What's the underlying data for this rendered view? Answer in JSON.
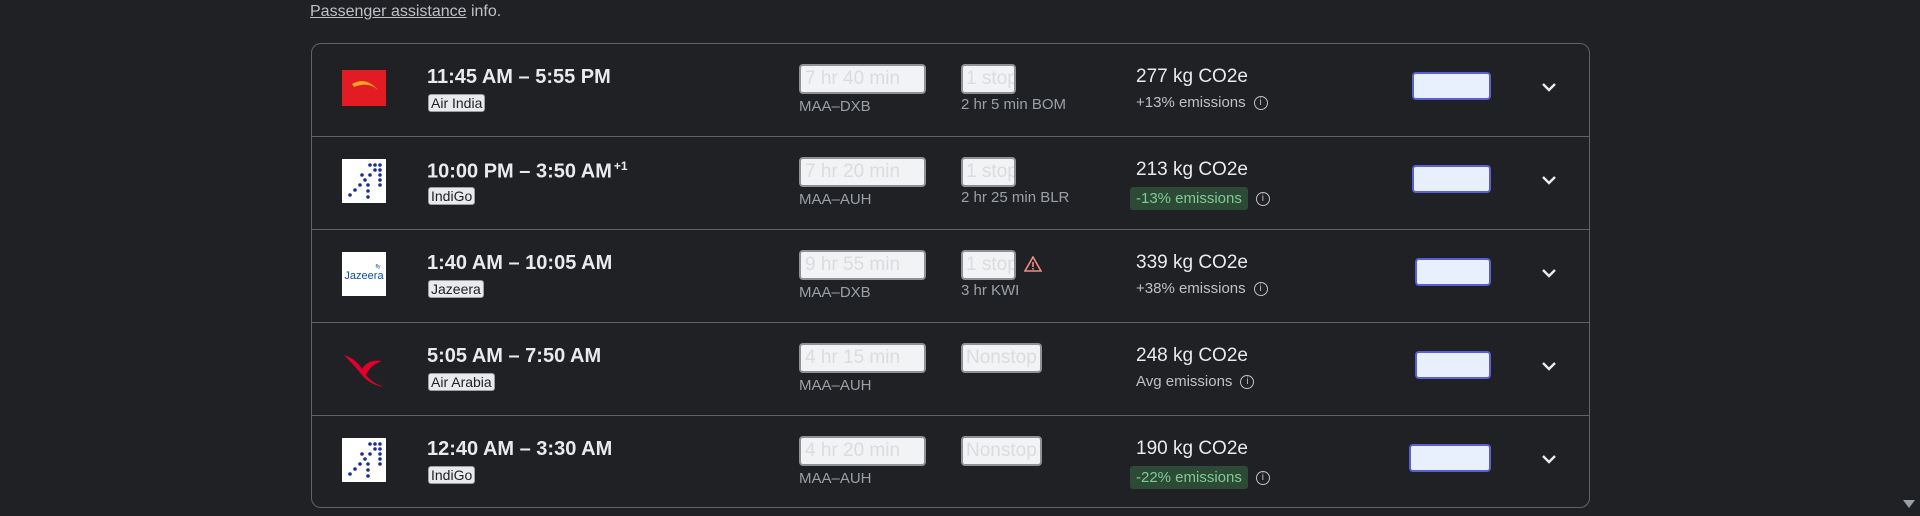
{
  "note": {
    "link": "Passenger assistance",
    "suffix": " info."
  },
  "flights": [
    {
      "times": "11:45 AM – 5:55 PM",
      "day_offset": "",
      "airline": "Air India",
      "logo": "air-india-logo",
      "duration": "7 hr 40 min",
      "stops": "1 stop",
      "route": "MAA–DXB",
      "layover": "2 hr 5 min BOM",
      "warning": false,
      "co2": "277 kg CO2e",
      "emissions": "+13% emissions",
      "emissions_style": "plain",
      "price": ""
    },
    {
      "times": "10:00 PM – 3:50 AM",
      "day_offset": "+1",
      "airline": "IndiGo",
      "logo": "indigo-logo",
      "duration": "7 hr 20 min",
      "stops": "1 stop",
      "route": "MAA–AUH",
      "layover": "2 hr 25 min BLR",
      "warning": false,
      "co2": "213 kg CO2e",
      "emissions": "-13% emissions",
      "emissions_style": "pill",
      "price": ""
    },
    {
      "times": "1:40 AM – 10:05 AM",
      "day_offset": "",
      "airline": "Jazeera",
      "logo": "jazeera-logo",
      "duration": "9 hr 55 min",
      "stops": "1 stop",
      "route": "MAA–DXB",
      "layover": "3 hr KWI",
      "warning": true,
      "co2": "339 kg CO2e",
      "emissions": "+38% emissions",
      "emissions_style": "plain",
      "price": ""
    },
    {
      "times": "5:05 AM – 7:50 AM",
      "day_offset": "",
      "airline": "Air Arabia",
      "logo": "air-arabia-logo",
      "duration": "4 hr 15 min",
      "stops": "Nonstop",
      "route": "MAA–AUH",
      "layover": "",
      "warning": false,
      "co2": "248 kg CO2e",
      "emissions": "Avg emissions",
      "emissions_style": "plain",
      "price": ""
    },
    {
      "times": "12:40 AM – 3:30 AM",
      "day_offset": "",
      "airline": "IndiGo",
      "logo": "indigo-logo",
      "duration": "4 hr 20 min",
      "stops": "Nonstop",
      "route": "MAA–AUH",
      "layover": "",
      "warning": false,
      "co2": "190 kg CO2e",
      "emissions": "-22% emissions",
      "emissions_style": "pill",
      "price": ""
    }
  ],
  "colors": {
    "background": "#202124",
    "border": "#5f6368",
    "price_border": "#5b5fd6",
    "pill_bg": "#2c4a36",
    "pill_text": "#81c995"
  }
}
